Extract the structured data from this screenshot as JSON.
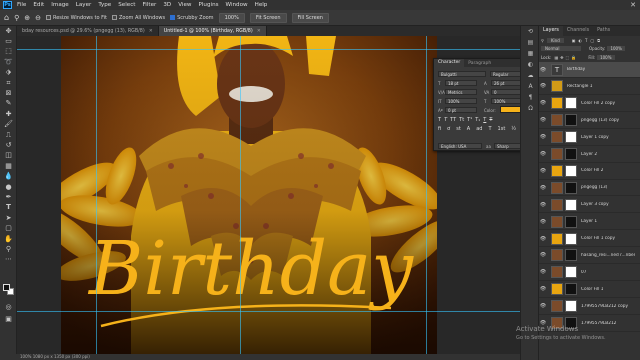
{
  "menubar": {
    "app_logo": "Ps",
    "items": [
      "File",
      "Edit",
      "Image",
      "Layer",
      "Type",
      "Select",
      "Filter",
      "3D",
      "View",
      "Plugins",
      "Window",
      "Help"
    ]
  },
  "options": {
    "resize_windows": "Resize Windows to Fit",
    "zoom_all": "Zoom All Windows",
    "scrubby_zoom": "Scrubby Zoom",
    "zoom_value": "100%",
    "fit_screen": "Fit Screen",
    "fill_screen": "Fill Screen"
  },
  "tabs": [
    {
      "label": "bday resources.psd @ 29.6% (pngegg (13), RGB/8)",
      "active": false
    },
    {
      "label": "Untitled-1 @ 100% (Birthday, RGB/8)",
      "active": true
    }
  ],
  "canvas": {
    "headline": "Birthday",
    "headline_color": "#f6b21a"
  },
  "status": {
    "text": "100%    1080 px x 1350 px (300 ppi)"
  },
  "character_panel": {
    "tabs": [
      "Character",
      "Paragraph"
    ],
    "font_family": "Bulgatti",
    "font_style": "Regular",
    "font_size": "18 pt",
    "leading": "26 pt",
    "kerning": "Metrics",
    "tracking": "0",
    "vertical_scale": "100%",
    "horizontal_scale": "100%",
    "baseline_shift": "0 pt",
    "color_label": "Color:",
    "color": "#f6b21a",
    "language": "English: USA",
    "antialias": "Sharp"
  },
  "layers_panel": {
    "tabs": [
      "Layers",
      "Channels",
      "Paths"
    ],
    "filter_label": "Kind",
    "blend_mode": "Normal",
    "opacity_label": "Opacity:",
    "opacity": "100%",
    "lock_label": "Lock:",
    "fill_label": "Fill:",
    "fill": "100%",
    "layers": [
      {
        "name": "Birthday",
        "kind": "text",
        "selected": true
      },
      {
        "name": "Rectangle 1",
        "kind": "shape",
        "selected": false
      },
      {
        "name": "Color Fill 2 copy",
        "kind": "fill",
        "selected": false
      },
      {
        "name": "pngegg (13) copy",
        "kind": "image",
        "selected": false
      },
      {
        "name": "Layer 1 copy",
        "kind": "image",
        "selected": false
      },
      {
        "name": "Layer 2",
        "kind": "image",
        "selected": false
      },
      {
        "name": "Color Fill 2",
        "kind": "fill",
        "selected": false
      },
      {
        "name": "pngegg (13)",
        "kind": "image",
        "selected": false
      },
      {
        "name": "Layer 3 copy",
        "kind": "image",
        "selected": false
      },
      {
        "name": "Layer 1",
        "kind": "image",
        "selected": false
      },
      {
        "name": "Color Fill 1 copy",
        "kind": "fill",
        "selected": false
      },
      {
        "name": "hasang_resi...ned r...nber",
        "kind": "image",
        "selected": false
      },
      {
        "name": "07",
        "kind": "image",
        "selected": false
      },
      {
        "name": "Color Fill 1",
        "kind": "fill",
        "selected": false
      },
      {
        "name": "17995579LB212 copy",
        "kind": "image",
        "selected": false
      },
      {
        "name": "17995579LB212",
        "kind": "image",
        "selected": false
      }
    ]
  },
  "watermark": {
    "title": "Activate Windows",
    "subtitle": "Go to Settings to activate Windows."
  }
}
